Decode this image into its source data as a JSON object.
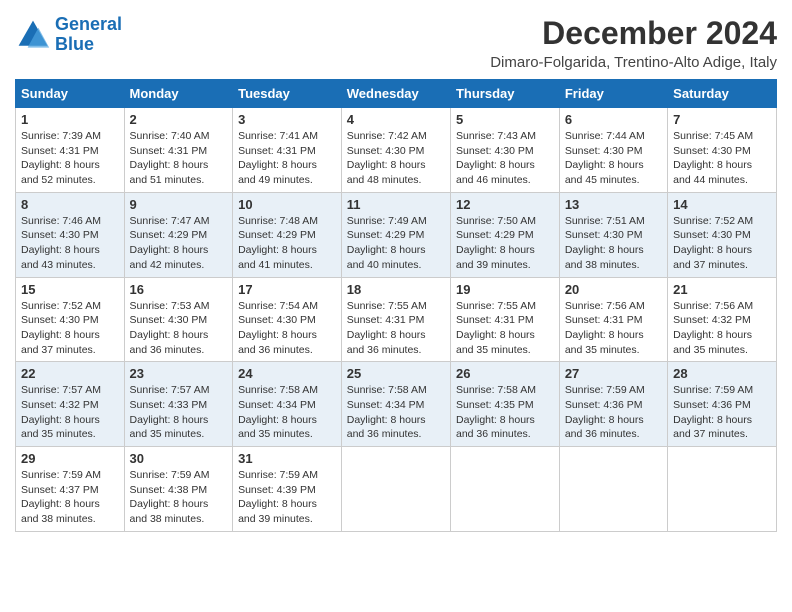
{
  "header": {
    "logo_line1": "General",
    "logo_line2": "Blue",
    "month_title": "December 2024",
    "location": "Dimaro-Folgarida, Trentino-Alto Adige, Italy"
  },
  "weekdays": [
    "Sunday",
    "Monday",
    "Tuesday",
    "Wednesday",
    "Thursday",
    "Friday",
    "Saturday"
  ],
  "weeks": [
    [
      {
        "day": "1",
        "info": "Sunrise: 7:39 AM\nSunset: 4:31 PM\nDaylight: 8 hours and 52 minutes."
      },
      {
        "day": "2",
        "info": "Sunrise: 7:40 AM\nSunset: 4:31 PM\nDaylight: 8 hours and 51 minutes."
      },
      {
        "day": "3",
        "info": "Sunrise: 7:41 AM\nSunset: 4:31 PM\nDaylight: 8 hours and 49 minutes."
      },
      {
        "day": "4",
        "info": "Sunrise: 7:42 AM\nSunset: 4:30 PM\nDaylight: 8 hours and 48 minutes."
      },
      {
        "day": "5",
        "info": "Sunrise: 7:43 AM\nSunset: 4:30 PM\nDaylight: 8 hours and 46 minutes."
      },
      {
        "day": "6",
        "info": "Sunrise: 7:44 AM\nSunset: 4:30 PM\nDaylight: 8 hours and 45 minutes."
      },
      {
        "day": "7",
        "info": "Sunrise: 7:45 AM\nSunset: 4:30 PM\nDaylight: 8 hours and 44 minutes."
      }
    ],
    [
      {
        "day": "8",
        "info": "Sunrise: 7:46 AM\nSunset: 4:30 PM\nDaylight: 8 hours and 43 minutes."
      },
      {
        "day": "9",
        "info": "Sunrise: 7:47 AM\nSunset: 4:29 PM\nDaylight: 8 hours and 42 minutes."
      },
      {
        "day": "10",
        "info": "Sunrise: 7:48 AM\nSunset: 4:29 PM\nDaylight: 8 hours and 41 minutes."
      },
      {
        "day": "11",
        "info": "Sunrise: 7:49 AM\nSunset: 4:29 PM\nDaylight: 8 hours and 40 minutes."
      },
      {
        "day": "12",
        "info": "Sunrise: 7:50 AM\nSunset: 4:29 PM\nDaylight: 8 hours and 39 minutes."
      },
      {
        "day": "13",
        "info": "Sunrise: 7:51 AM\nSunset: 4:30 PM\nDaylight: 8 hours and 38 minutes."
      },
      {
        "day": "14",
        "info": "Sunrise: 7:52 AM\nSunset: 4:30 PM\nDaylight: 8 hours and 37 minutes."
      }
    ],
    [
      {
        "day": "15",
        "info": "Sunrise: 7:52 AM\nSunset: 4:30 PM\nDaylight: 8 hours and 37 minutes."
      },
      {
        "day": "16",
        "info": "Sunrise: 7:53 AM\nSunset: 4:30 PM\nDaylight: 8 hours and 36 minutes."
      },
      {
        "day": "17",
        "info": "Sunrise: 7:54 AM\nSunset: 4:30 PM\nDaylight: 8 hours and 36 minutes."
      },
      {
        "day": "18",
        "info": "Sunrise: 7:55 AM\nSunset: 4:31 PM\nDaylight: 8 hours and 36 minutes."
      },
      {
        "day": "19",
        "info": "Sunrise: 7:55 AM\nSunset: 4:31 PM\nDaylight: 8 hours and 35 minutes."
      },
      {
        "day": "20",
        "info": "Sunrise: 7:56 AM\nSunset: 4:31 PM\nDaylight: 8 hours and 35 minutes."
      },
      {
        "day": "21",
        "info": "Sunrise: 7:56 AM\nSunset: 4:32 PM\nDaylight: 8 hours and 35 minutes."
      }
    ],
    [
      {
        "day": "22",
        "info": "Sunrise: 7:57 AM\nSunset: 4:32 PM\nDaylight: 8 hours and 35 minutes."
      },
      {
        "day": "23",
        "info": "Sunrise: 7:57 AM\nSunset: 4:33 PM\nDaylight: 8 hours and 35 minutes."
      },
      {
        "day": "24",
        "info": "Sunrise: 7:58 AM\nSunset: 4:34 PM\nDaylight: 8 hours and 35 minutes."
      },
      {
        "day": "25",
        "info": "Sunrise: 7:58 AM\nSunset: 4:34 PM\nDaylight: 8 hours and 36 minutes."
      },
      {
        "day": "26",
        "info": "Sunrise: 7:58 AM\nSunset: 4:35 PM\nDaylight: 8 hours and 36 minutes."
      },
      {
        "day": "27",
        "info": "Sunrise: 7:59 AM\nSunset: 4:36 PM\nDaylight: 8 hours and 36 minutes."
      },
      {
        "day": "28",
        "info": "Sunrise: 7:59 AM\nSunset: 4:36 PM\nDaylight: 8 hours and 37 minutes."
      }
    ],
    [
      {
        "day": "29",
        "info": "Sunrise: 7:59 AM\nSunset: 4:37 PM\nDaylight: 8 hours and 38 minutes."
      },
      {
        "day": "30",
        "info": "Sunrise: 7:59 AM\nSunset: 4:38 PM\nDaylight: 8 hours and 38 minutes."
      },
      {
        "day": "31",
        "info": "Sunrise: 7:59 AM\nSunset: 4:39 PM\nDaylight: 8 hours and 39 minutes."
      },
      null,
      null,
      null,
      null
    ]
  ]
}
